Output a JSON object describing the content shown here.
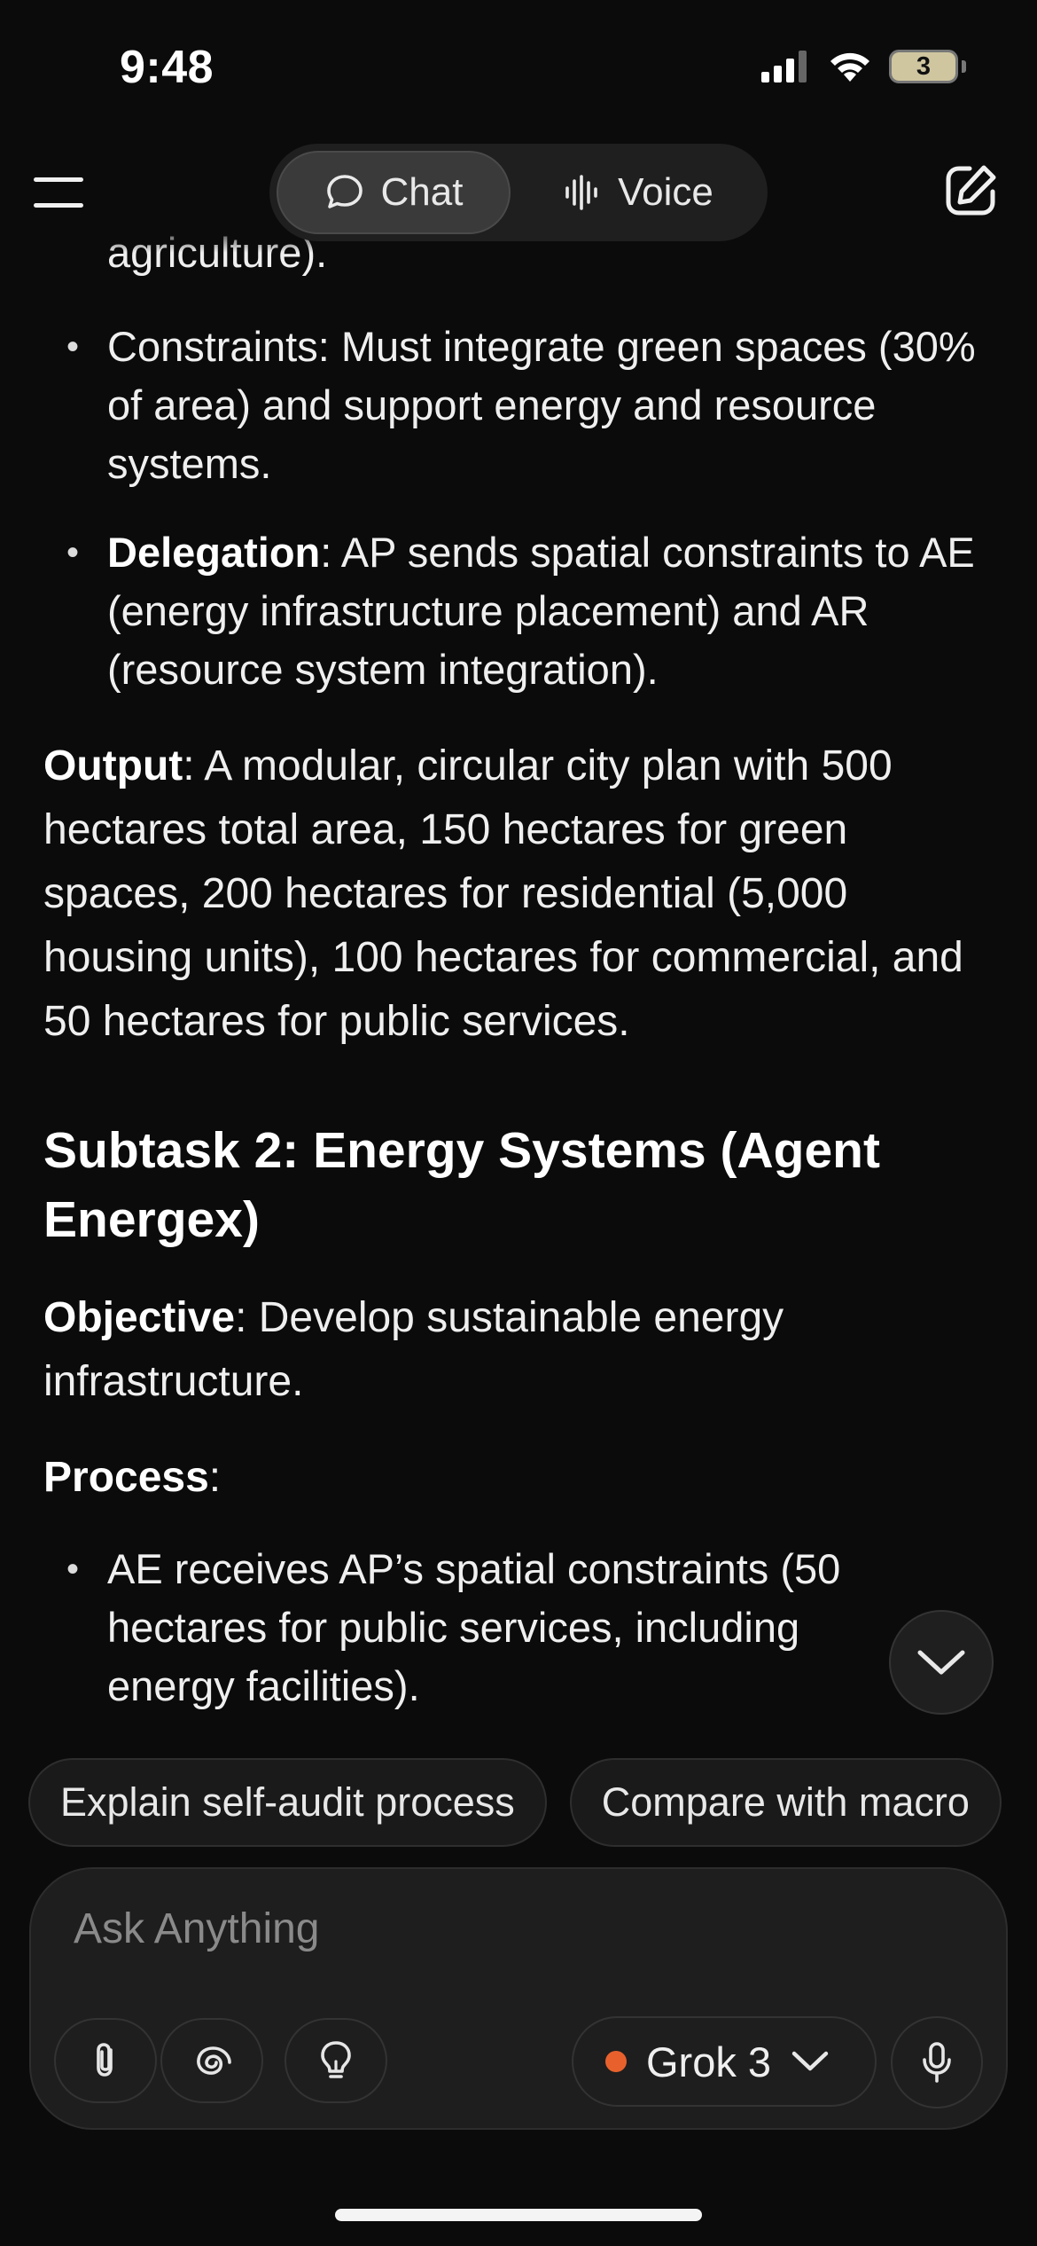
{
  "status_bar": {
    "time": "9:48",
    "battery_level": "3",
    "icons": [
      "cellular-signal-icon",
      "wifi-icon",
      "battery-icon"
    ]
  },
  "header": {
    "tabs": [
      {
        "label": "Chat",
        "icon": "chat-bubble-icon",
        "active": true
      },
      {
        "label": "Voice",
        "icon": "waveform-icon",
        "active": false
      }
    ]
  },
  "content": {
    "clipped_line": "agriculture).",
    "bullets_top": [
      {
        "text": "Constraints: Must integrate green spaces (30% of area) and support energy and resource systems."
      },
      {
        "bold": "Delegation",
        "text": ": AP sends spatial constraints to AE (energy infrastructure placement) and AR (resource system integration)."
      }
    ],
    "output": {
      "bold": "Output",
      "text": ": A modular, circular city plan with 500 hectares total area, 150 hectares for green spaces, 200 hectares for residential (5,000 housing units), 100 hectares for commercial, and 50 hectares for public services."
    },
    "subtask_heading": "Subtask 2: Energy Systems (Agent Energex)",
    "objective": {
      "bold": "Objective",
      "text": ": Develop sustainable energy infrastructure."
    },
    "process": {
      "bold": "Process",
      "text": ":"
    },
    "bullets_bottom": [
      {
        "text": "AE receives AP’s spatial constraints (50 hectares for public services, including energy facilities)."
      }
    ]
  },
  "suggestions": [
    "Explain self-audit process",
    "Compare with macro"
  ],
  "composer": {
    "placeholder": "Ask Anything",
    "model": "Grok 3",
    "model_dot_color": "#e8612c"
  },
  "colors": {
    "background": "#0b0b0b",
    "surface": "#1e1e1e",
    "text": "#efefef",
    "muted": "#8a8a8a"
  }
}
